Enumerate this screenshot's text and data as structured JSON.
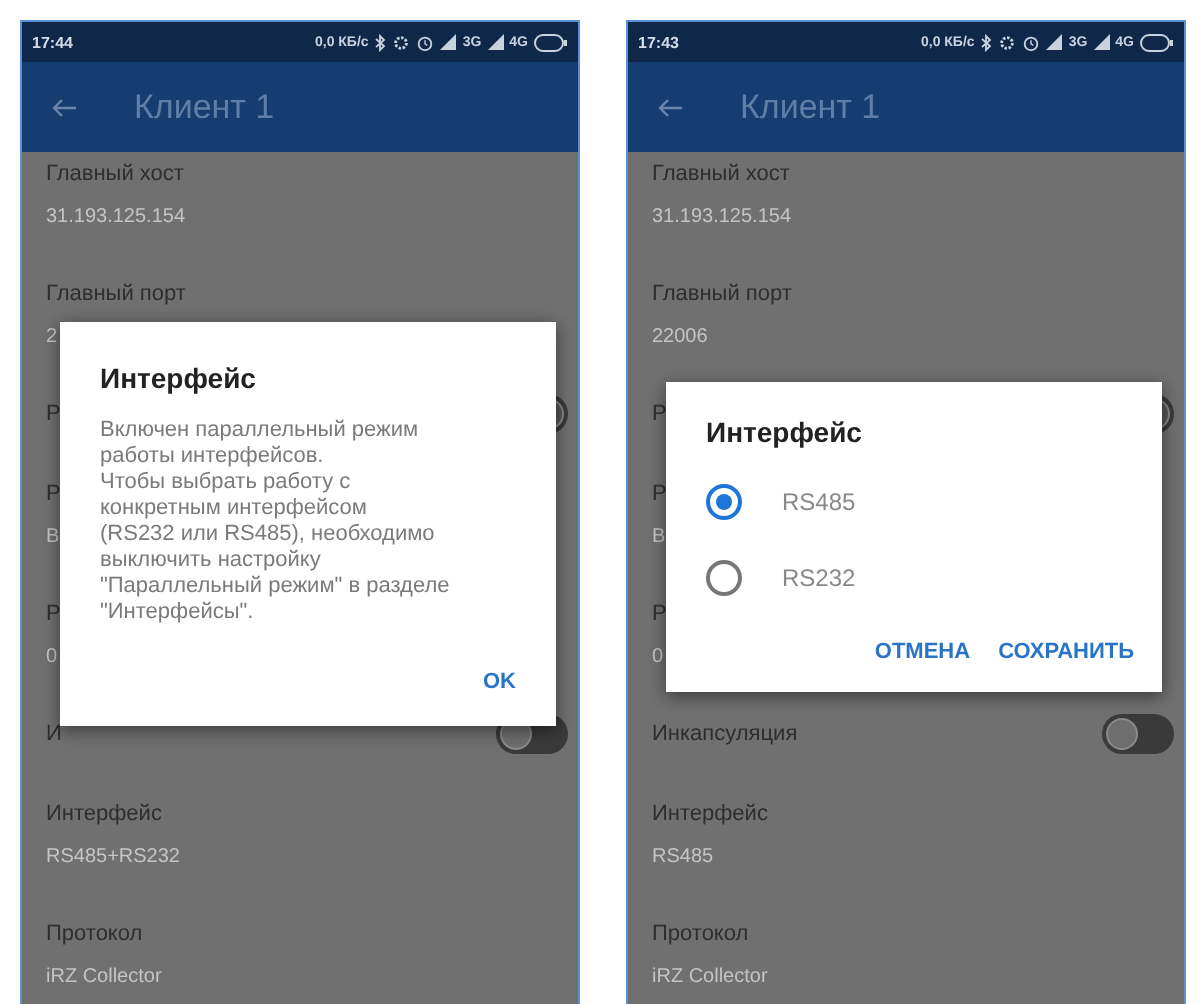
{
  "phones": [
    {
      "status_bar": {
        "time": "17:44",
        "speed": "0,0 КБ/с",
        "networks": [
          "3G",
          "4G"
        ]
      },
      "title": "Клиент 1",
      "fields": [
        {
          "kind": "value",
          "label": "Главный хост",
          "value": "31.193.125.154"
        },
        {
          "kind": "value",
          "label": "Главный порт",
          "value": "2"
        },
        {
          "kind": "switch",
          "label": "Р",
          "on": true
        },
        {
          "kind": "value",
          "label": "Р",
          "value": "В"
        },
        {
          "kind": "value",
          "label": "Р",
          "value": "0"
        },
        {
          "kind": "switch",
          "label": "И",
          "on": false
        },
        {
          "kind": "value",
          "label": "Интерфейс",
          "value": "RS485+RS232"
        },
        {
          "kind": "value",
          "label": "Протокол",
          "value": "iRZ Collector"
        }
      ],
      "dialog": {
        "kind": "message",
        "title": "Интерфейс",
        "text": "Включен параллельный режим\nработы интерфейсов.\nЧтобы выбрать работу с\nконкретным интерфейсом\n(RS232 или RS485), необходимо\nвыключить настройку\n\"Параллельный режим\" в разделе\n\"Интерфейсы\".",
        "buttons": [
          "OK"
        ]
      }
    },
    {
      "status_bar": {
        "time": "17:43",
        "speed": "0,0 КБ/с",
        "networks": [
          "3G",
          "4G"
        ]
      },
      "title": "Клиент 1",
      "fields": [
        {
          "kind": "value",
          "label": "Главный хост",
          "value": "31.193.125.154"
        },
        {
          "kind": "value",
          "label": "Главный порт",
          "value": "22006"
        },
        {
          "kind": "switch",
          "label": "Р",
          "on": true
        },
        {
          "kind": "value",
          "label": "Р",
          "value": "В"
        },
        {
          "kind": "value",
          "label": "Р",
          "value": "0"
        },
        {
          "kind": "switch",
          "label": "Инкапсуляция",
          "on": false
        },
        {
          "kind": "value",
          "label": "Интерфейс",
          "value": "RS485"
        },
        {
          "kind": "value",
          "label": "Протокол",
          "value": "iRZ Collector"
        }
      ],
      "dialog": {
        "kind": "choice",
        "title": "Интерфейс",
        "options": [
          {
            "label": "RS485",
            "selected": true
          },
          {
            "label": "RS232",
            "selected": false
          }
        ],
        "buttons": [
          "ОТМЕНА",
          "СОХРАНИТЬ"
        ]
      }
    }
  ]
}
